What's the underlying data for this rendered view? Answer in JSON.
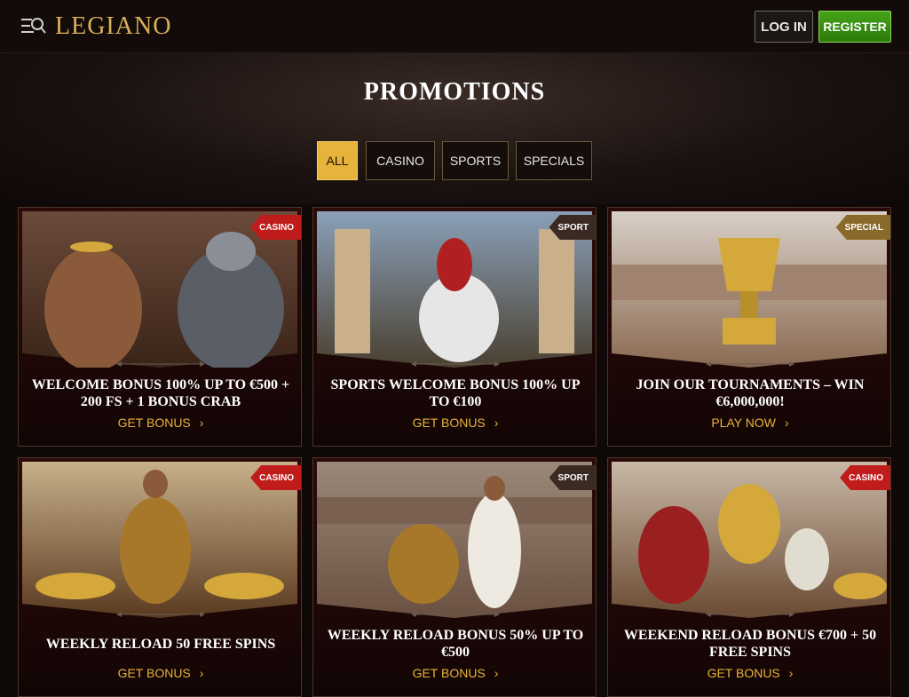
{
  "header": {
    "logo": "LEGIANO",
    "login_label": "LOG IN",
    "register_label": "REGISTER"
  },
  "page": {
    "title": "PROMOTIONS"
  },
  "filters": [
    {
      "label": "ALL",
      "active": true
    },
    {
      "label": "CASINO",
      "active": false
    },
    {
      "label": "SPORTS",
      "active": false
    },
    {
      "label": "SPECIALS",
      "active": false
    }
  ],
  "cards": [
    {
      "badge": "CASINO",
      "title": "WELCOME BONUS 100% UP TO €500 + 200 FS + 1 BONUS CRAB",
      "cta": "GET BONUS"
    },
    {
      "badge": "SPORT",
      "title": "SPORTS WELCOME BONUS 100% UP TO €100",
      "cta": "GET BONUS"
    },
    {
      "badge": "SPECIAL",
      "title": "JOIN OUR TOURNAMENTS – WIN €6,000,000!",
      "cta": "PLAY NOW"
    },
    {
      "badge": "CASINO",
      "title": "WEEKLY RELOAD 50 FREE SPINS",
      "cta": "GET BONUS"
    },
    {
      "badge": "SPORT",
      "title": "WEEKLY RELOAD BONUS 50% UP TO €500",
      "cta": "GET BONUS"
    },
    {
      "badge": "CASINO",
      "title": "WEEKEND RELOAD BONUS €700 + 50 FREE SPINS",
      "cta": "GET BONUS"
    }
  ],
  "colors": {
    "accent": "#e8b33a",
    "casino_badge": "#c11c1c",
    "register": "#2c7a0b"
  },
  "icons": {
    "menu": "menu-search-icon",
    "cta": "chevron-right-icon"
  }
}
